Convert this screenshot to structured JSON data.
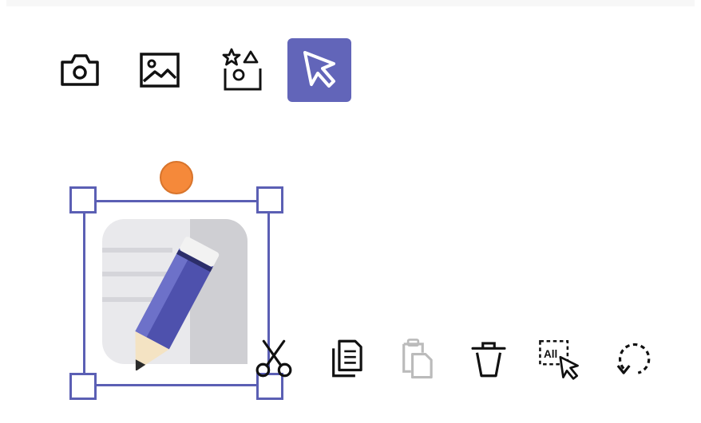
{
  "toolbar": {
    "tools": [
      {
        "name": "camera",
        "icon": "camera-icon",
        "active": false
      },
      {
        "name": "image",
        "icon": "image-icon",
        "active": false
      },
      {
        "name": "shapes",
        "icon": "shapes-icon",
        "active": false
      },
      {
        "name": "select",
        "icon": "cursor-arrow-icon",
        "active": true
      }
    ],
    "active_color": "#6265b9"
  },
  "canvas": {
    "selected_object": {
      "type": "sticker",
      "icon": "note-pencil-icon"
    },
    "selection_color": "#5b5fb4",
    "rotate_handle_color": "#f5893a"
  },
  "context_menu": {
    "actions": [
      {
        "name": "cut",
        "icon": "scissors-icon",
        "enabled": true
      },
      {
        "name": "copy",
        "icon": "copy-icon",
        "enabled": true
      },
      {
        "name": "paste",
        "icon": "paste-icon",
        "enabled": false
      },
      {
        "name": "delete",
        "icon": "trash-icon",
        "enabled": true
      },
      {
        "name": "select-all",
        "icon": "select-all-icon",
        "label": "All",
        "enabled": true
      },
      {
        "name": "rotate",
        "icon": "rotate-icon",
        "enabled": true
      }
    ]
  }
}
